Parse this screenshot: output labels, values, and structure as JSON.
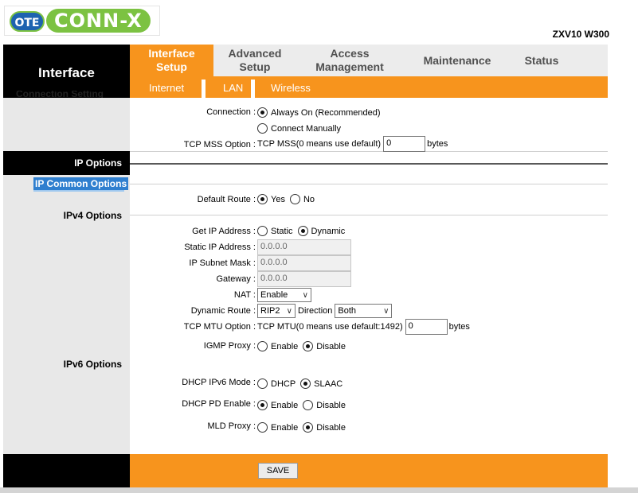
{
  "logo": {
    "ote": "OTE",
    "brand": "CONN-X"
  },
  "model": "ZXV10 W300",
  "header": {
    "section_title": "Interface"
  },
  "nav": {
    "tabs": [
      {
        "label": "Interface Setup"
      },
      {
        "label": "Advanced Setup"
      },
      {
        "label": "Access Management"
      },
      {
        "label": "Maintenance"
      },
      {
        "label": "Status"
      }
    ],
    "subtabs": [
      "Internet",
      "LAN",
      "Wireless"
    ]
  },
  "sidebar": {
    "connection_setting": "Connection Setting",
    "ip_options": "IP Options",
    "ip_common_options": "IP Common Options",
    "ipv4_options": "IPv4 Options",
    "ipv6_options": "IPv6 Options"
  },
  "form": {
    "connection": {
      "label": "Connection :",
      "always_on": "Always On (Recommended)",
      "manual": "Connect Manually"
    },
    "tcp_mss": {
      "label": "TCP MSS Option :",
      "text": "TCP MSS(0 means use default)",
      "value": "0",
      "unit": "bytes"
    },
    "default_route": {
      "label": "Default Route :",
      "yes": "Yes",
      "no": "No"
    },
    "get_ip": {
      "label": "Get IP Address :",
      "static": "Static",
      "dynamic": "Dynamic"
    },
    "static_ip": {
      "label": "Static IP Address :",
      "value": "0.0.0.0"
    },
    "subnet": {
      "label": "IP Subnet Mask :",
      "value": "0.0.0.0"
    },
    "gateway": {
      "label": "Gateway :",
      "value": "0.0.0.0"
    },
    "nat": {
      "label": "NAT :",
      "value": "Enable"
    },
    "dynamic_route": {
      "label": "Dynamic Route :",
      "value": "RIP2",
      "direction_label": "Direction",
      "direction_value": "Both"
    },
    "tcp_mtu": {
      "label": "TCP MTU Option :",
      "text": "TCP MTU(0 means use default:1492)",
      "value": "0",
      "unit": "bytes"
    },
    "igmp": {
      "label": "IGMP Proxy :",
      "enable": "Enable",
      "disable": "Disable"
    },
    "dhcp_ipv6": {
      "label": "DHCP IPv6 Mode :",
      "dhcp": "DHCP",
      "slaac": "SLAAC"
    },
    "dhcp_pd": {
      "label": "DHCP PD Enable :",
      "enable": "Enable",
      "disable": "Disable"
    },
    "mld": {
      "label": "MLD Proxy :",
      "enable": "Enable",
      "disable": "Disable"
    }
  },
  "footer": {
    "save": "SAVE"
  }
}
